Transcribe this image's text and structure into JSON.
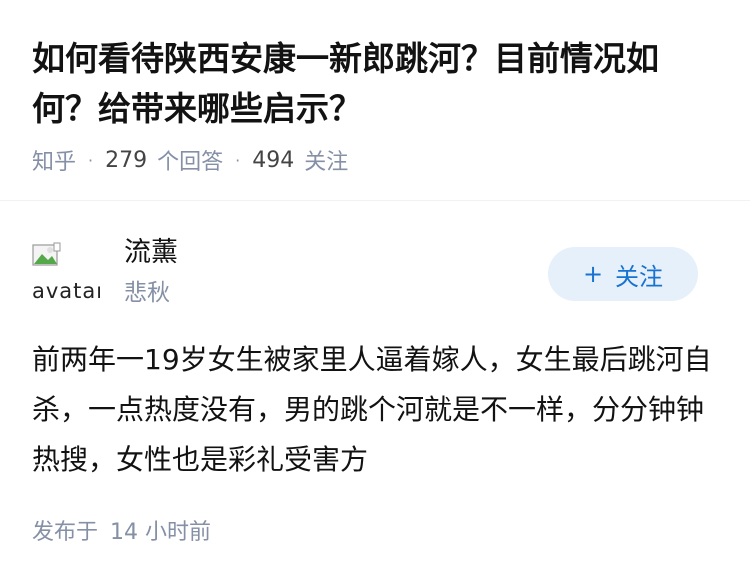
{
  "question": {
    "title": "如何看待陕西安康一新郎跳河？目前情况如何？给带来哪些启示？",
    "source": "知乎",
    "answer_count": "279",
    "answer_label": "个回答",
    "follower_count": "494",
    "follower_label": "关注",
    "separator": "·"
  },
  "answer": {
    "author": {
      "avatar_alt": "avatar",
      "name": "流薰",
      "bio": "悲秋"
    },
    "follow_button": {
      "icon": "plus-icon",
      "plus": "+",
      "label": "关注"
    },
    "content": "前两年一19岁女生被家里人逼着嫁人，女生最后跳河自杀，一点热度没有，男的跳个河就是不一样，分分钟钟热搜，女性也是彩礼受害方",
    "time": {
      "prefix": "发布于",
      "value": "14 小时前"
    }
  },
  "colors": {
    "title": "#121212",
    "meta": "#8590a6",
    "follow_bg": "#e6f0fa",
    "follow_text": "#1772d0"
  }
}
